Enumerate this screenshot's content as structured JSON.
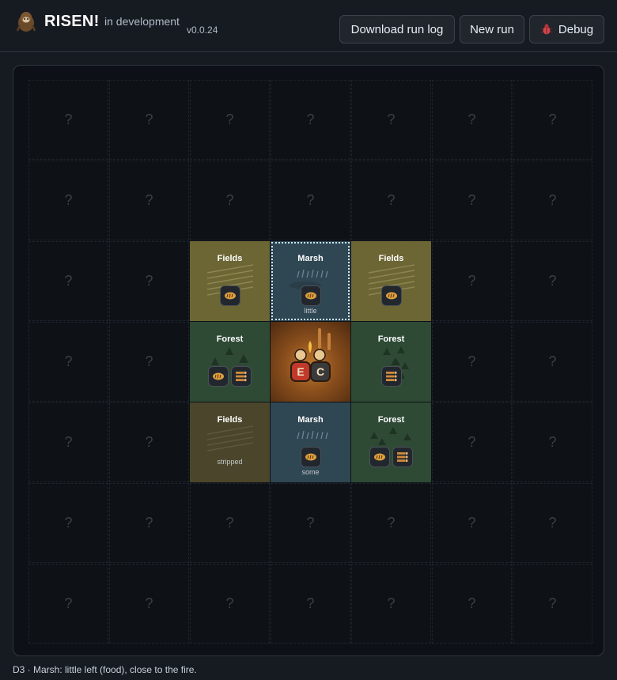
{
  "app": {
    "title": "RISEN!",
    "subtitle": "in development",
    "version": "v0.0.24",
    "logo_icon": "bigfoot-icon"
  },
  "toolbar": {
    "download_label": "Download run log",
    "new_run_label": "New run",
    "debug_label": "Debug",
    "debug_icon": "bug-icon"
  },
  "map": {
    "unknown_symbol": "?",
    "tiles": {
      "fields_nw": {
        "name": "Fields",
        "resources": [
          "food-icon"
        ]
      },
      "marsh_n": {
        "name": "Marsh",
        "resources": [
          "food-icon"
        ],
        "note": "little",
        "selected": true
      },
      "fields_ne": {
        "name": "Fields",
        "resources": [
          "food-icon"
        ]
      },
      "forest_w": {
        "name": "Forest",
        "resources": [
          "food-icon",
          "wood-icon"
        ]
      },
      "camp": {
        "members": [
          "E",
          "C"
        ],
        "member_colors": [
          "#c0392b",
          "#3a3a3a"
        ]
      },
      "forest_e": {
        "name": "Forest",
        "resources": [
          "wood-icon"
        ]
      },
      "fields_sw": {
        "name": "Fields",
        "resources": [],
        "note": "stripped"
      },
      "marsh_s": {
        "name": "Marsh",
        "resources": [
          "food-icon"
        ],
        "note": "some"
      },
      "forest_se": {
        "name": "Forest",
        "resources": [
          "food-icon",
          "wood-icon"
        ]
      }
    }
  },
  "status": {
    "text": "D3 · Marsh: little left (food), close to the fire."
  },
  "colors": {
    "fields": "#6c6634",
    "fields_stripped": "#4b462b",
    "marsh": "#2f4653",
    "forest": "#2e4a35",
    "camp": "#8a4e1c",
    "food": "#e0a040",
    "wood": "#d08a3a"
  }
}
